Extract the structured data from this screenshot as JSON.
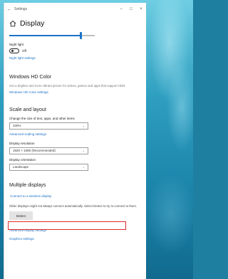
{
  "window": {
    "title": "Settings",
    "back_glyph": "←",
    "minimize_glyph": "–",
    "maximize_glyph": "□",
    "close_glyph": "×"
  },
  "page": {
    "title": "Display",
    "icon": "home-icon",
    "brightness_level": 0.83
  },
  "night_light": {
    "label": "Night light",
    "toggle_state": "Off",
    "settings_link": "Night light settings"
  },
  "hd_color": {
    "title": "Windows HD Color",
    "description": "Get a brighter and more vibrant picture for videos, games and apps that support HDR.",
    "settings_link": "Windows HD Color settings"
  },
  "scale_layout": {
    "title": "Scale and layout",
    "size_label": "Change the size of text, apps, and other items",
    "size_value": "100%",
    "advanced_link": "Advanced scaling settings",
    "resolution_label": "Display resolution",
    "resolution_value": "1920 × 1080 (Recommended)",
    "orientation_label": "Display orientation",
    "orientation_value": "Landscape"
  },
  "multiple_displays": {
    "title": "Multiple displays",
    "connect_link": "Connect to a wireless display",
    "note": "Older displays might not always connect automatically. Select Detect to try to connect to them.",
    "detect_button": "Detect",
    "advanced_link": "Advanced display settings",
    "graphics_link": "Graphics settings"
  },
  "colors": {
    "accent": "#1a73c8",
    "link": "#1a6fc4",
    "highlight": "#e02a2a"
  }
}
